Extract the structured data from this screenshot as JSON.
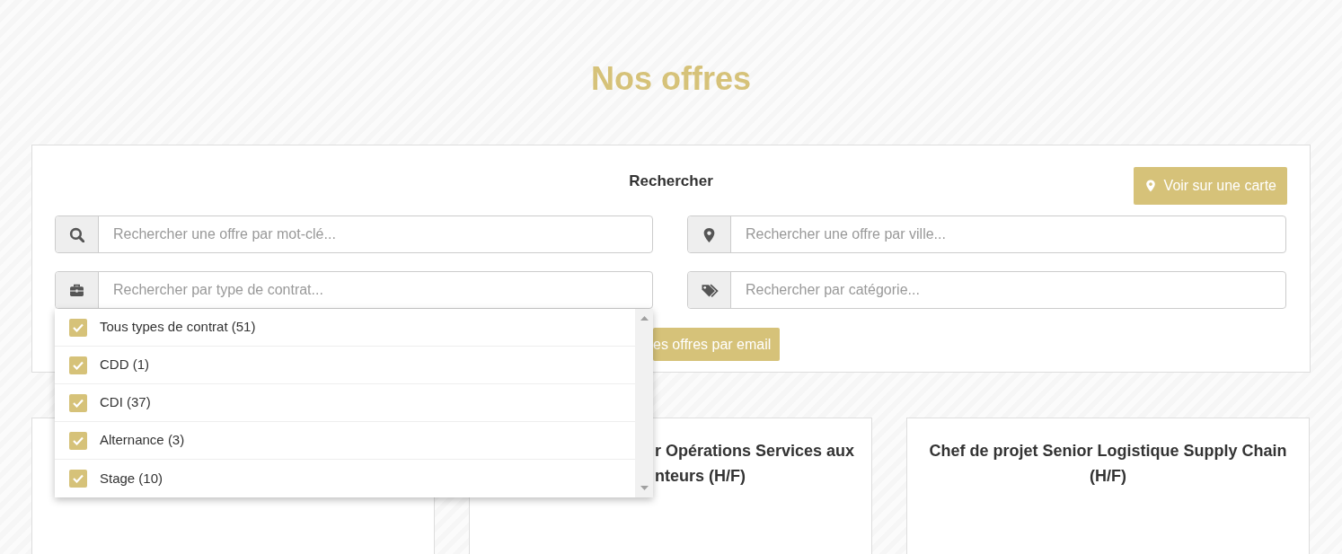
{
  "page_title": "Nos offres",
  "search_panel": {
    "title": "Rechercher",
    "map_button": "Voir sur une carte",
    "fields": [
      {
        "kind": "search",
        "placeholder": "Rechercher une offre par mot-clé..."
      },
      {
        "kind": "pin",
        "placeholder": "Rechercher une offre par ville..."
      },
      {
        "kind": "briefcase",
        "placeholder": "Rechercher par type de contrat..."
      },
      {
        "kind": "tags",
        "placeholder": "Rechercher par catégorie..."
      }
    ],
    "email_button": "es offres par email"
  },
  "contract_dropdown": [
    {
      "label": "Tous types de contrat (51)",
      "checked": true
    },
    {
      "label": "CDD (1)",
      "checked": true
    },
    {
      "label": "CDI (37)",
      "checked": true
    },
    {
      "label": "Alternance (3)",
      "checked": true
    },
    {
      "label": "Stage (10)",
      "checked": true
    }
  ],
  "offers": [
    {
      "kind": "card"
    },
    {
      "kind": "card",
      "title": "r Opérations Services aux\nnteurs (H/F)"
    },
    {
      "kind": "card",
      "title": "Chef de projet Senior Logistique Supply Chain (H/F)"
    }
  ]
}
